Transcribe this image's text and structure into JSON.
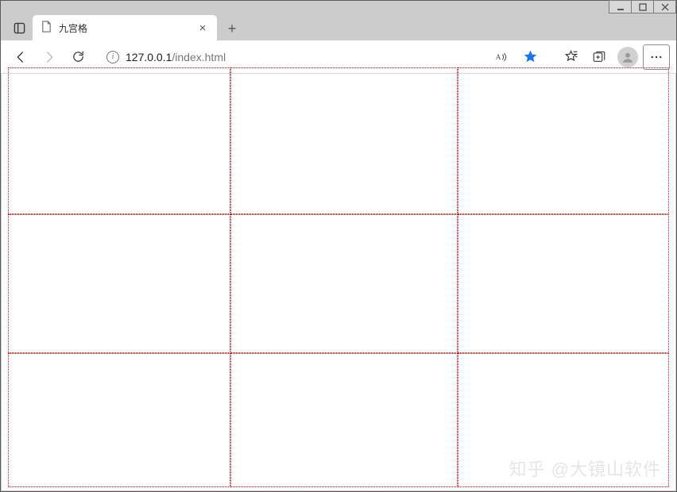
{
  "window": {
    "controls": {
      "minimize": "minimize",
      "maximize": "maximize",
      "close": "close"
    }
  },
  "tab": {
    "title": "九宫格",
    "close_label": "×"
  },
  "newtab_label": "+",
  "address": {
    "info_glyph": "i",
    "host": "127.0.0.1",
    "path": "/index.html"
  },
  "icons": {
    "tab_actions": "tab-actions",
    "back": "back",
    "forward": "forward",
    "refresh": "refresh",
    "read_aloud": "read-aloud",
    "favorite": "favorite",
    "favorites_list": "favorites-list",
    "collections": "collections",
    "profile": "profile",
    "more": "more"
  },
  "grid": {
    "rows": 3,
    "cols": 3,
    "border_color": "#d11"
  },
  "watermark": "知乎 @大镜山软件"
}
